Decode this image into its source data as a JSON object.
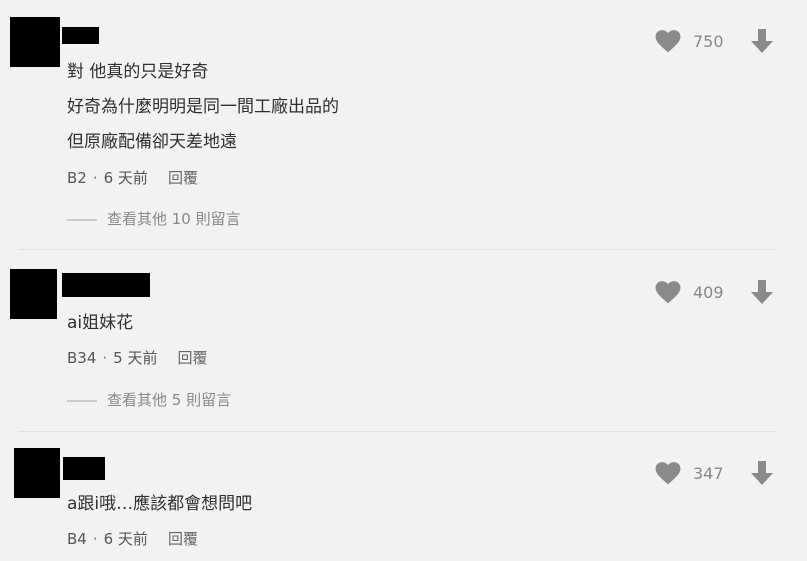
{
  "comments": [
    {
      "lines": [
        "對 他真的只是好奇",
        "好奇為什麼明明是同一間工廠出品的",
        "但原廠配備卻天差地遠"
      ],
      "floor": "B2",
      "time": "6 天前",
      "reply_label": "回覆",
      "likes": "750",
      "more_replies": "查看其他 10 則留言"
    },
    {
      "lines": [
        "ai姐妹花"
      ],
      "floor": "B34",
      "time": "5 天前",
      "reply_label": "回覆",
      "likes": "409",
      "more_replies": "查看其他 5 則留言"
    },
    {
      "lines": [
        "a跟i哦…應該都會想問吧"
      ],
      "floor": "B4",
      "time": "6 天前",
      "reply_label": "回覆",
      "likes": "347"
    }
  ],
  "separator": "·",
  "colors": {
    "background": "#f2f2f2",
    "icon": "#8a8a8a",
    "text": "#2f2f2f"
  }
}
